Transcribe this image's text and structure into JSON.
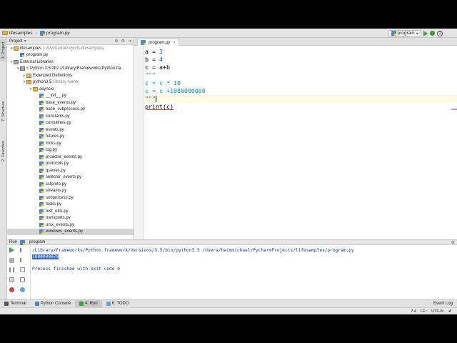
{
  "navbar": {
    "project": "lifesamples",
    "file": "program.py",
    "run_config": "program"
  },
  "project_panel": {
    "title": "Project",
    "tree": [
      {
        "label": "lifesamples",
        "note": "(~/PycharmProjects/lifesamples)",
        "kind": "folder",
        "indent": 0,
        "open": true
      },
      {
        "label": "program.py",
        "note": "",
        "kind": "py",
        "indent": 1,
        "open": null
      },
      {
        "label": "External Libraries",
        "note": "",
        "kind": "lib",
        "indent": 0,
        "open": true
      },
      {
        "label": "< Python 3.5.0b2 (/Library/Frameworks/Python.fra",
        "note": "",
        "kind": "lib",
        "indent": 1,
        "open": true
      },
      {
        "label": "Extended Definitions",
        "note": "",
        "kind": "folder",
        "indent": 2,
        "open": false
      },
      {
        "label": "python3.5",
        "note": "(library home)",
        "kind": "folder",
        "indent": 2,
        "open": true
      },
      {
        "label": "asyncio",
        "note": "",
        "kind": "folder",
        "indent": 3,
        "open": true
      },
      {
        "label": "__init__.py",
        "note": "",
        "kind": "py",
        "indent": 4,
        "open": null
      },
      {
        "label": "base_events.py",
        "note": "",
        "kind": "py",
        "indent": 4,
        "open": null
      },
      {
        "label": "base_subprocess.py",
        "note": "",
        "kind": "py",
        "indent": 4,
        "open": null
      },
      {
        "label": "constants.py",
        "note": "",
        "kind": "py",
        "indent": 4,
        "open": null
      },
      {
        "label": "coroutines.py",
        "note": "",
        "kind": "py",
        "indent": 4,
        "open": null
      },
      {
        "label": "events.py",
        "note": "",
        "kind": "py",
        "indent": 4,
        "open": null
      },
      {
        "label": "futures.py",
        "note": "",
        "kind": "py",
        "indent": 4,
        "open": null
      },
      {
        "label": "locks.py",
        "note": "",
        "kind": "py",
        "indent": 4,
        "open": null
      },
      {
        "label": "log.py",
        "note": "",
        "kind": "py",
        "indent": 4,
        "open": null
      },
      {
        "label": "proactor_events.py",
        "note": "",
        "kind": "py",
        "indent": 4,
        "open": null
      },
      {
        "label": "protocols.py",
        "note": "",
        "kind": "py",
        "indent": 4,
        "open": null
      },
      {
        "label": "queues.py",
        "note": "",
        "kind": "py",
        "indent": 4,
        "open": null
      },
      {
        "label": "selector_events.py",
        "note": "",
        "kind": "py",
        "indent": 4,
        "open": null
      },
      {
        "label": "sslproto.py",
        "note": "",
        "kind": "py",
        "indent": 4,
        "open": null
      },
      {
        "label": "streams.py",
        "note": "",
        "kind": "py",
        "indent": 4,
        "open": null
      },
      {
        "label": "subprocess.py",
        "note": "",
        "kind": "py",
        "indent": 4,
        "open": null
      },
      {
        "label": "tasks.py",
        "note": "",
        "kind": "py",
        "indent": 4,
        "open": null
      },
      {
        "label": "test_utils.py",
        "note": "",
        "kind": "py",
        "indent": 4,
        "open": null
      },
      {
        "label": "transports.py",
        "note": "",
        "kind": "py",
        "indent": 4,
        "open": null
      },
      {
        "label": "unix_events.py",
        "note": "",
        "kind": "py",
        "indent": 4,
        "open": null
      },
      {
        "label": "windows_events.py",
        "note": "",
        "kind": "py",
        "indent": 4,
        "open": null,
        "selected": true
      }
    ]
  },
  "editor": {
    "tab": "program.py",
    "lines": [
      {
        "parts": [
          {
            "t": "a = ",
            "c": "kv"
          },
          {
            "t": "3",
            "c": "num"
          }
        ]
      },
      {
        "parts": [
          {
            "t": "b = ",
            "c": "kv"
          },
          {
            "t": "4",
            "c": "num"
          }
        ]
      },
      {
        "parts": [
          {
            "t": "c = a+b",
            "c": "kv"
          }
        ]
      },
      {
        "parts": [
          {
            "t": "\"\"\"",
            "c": "str"
          }
        ]
      },
      {
        "parts": [
          {
            "t": "c = c * 10",
            "c": "teal"
          }
        ]
      },
      {
        "parts": [
          {
            "t": "c = c +1000000000",
            "c": "teal"
          }
        ]
      },
      {
        "parts": [
          {
            "t": "\"\"\"",
            "c": "str"
          }
        ],
        "caret": true
      },
      {
        "parts": [
          {
            "t": "print(c)",
            "c": "kv"
          }
        ],
        "underline": true
      }
    ]
  },
  "run_panel": {
    "title": "Run",
    "config": "program",
    "command": "/Library/Frameworks/Python.framework/Versions/3.5/bin/python3.5 /Users/haimmichael/PycharmProjects/lifesamples/program.py",
    "result": "1000000070",
    "exit_message": "Process finished with exit code 0"
  },
  "bottom_tabs": [
    {
      "label": "Terminal",
      "active": false
    },
    {
      "label": "Python Console",
      "active": false
    },
    {
      "label": "4: Run",
      "active": true
    },
    {
      "label": "6: TODO",
      "active": false
    }
  ],
  "event_log": "Event Log",
  "status": {
    "position": "7:4",
    "line_sep": "LF↕",
    "encoding": "UTF-8↕"
  },
  "sidebar_tabs": {
    "project": "1: Project",
    "structure": "7: Structure",
    "favorites": "2: Favorites"
  }
}
